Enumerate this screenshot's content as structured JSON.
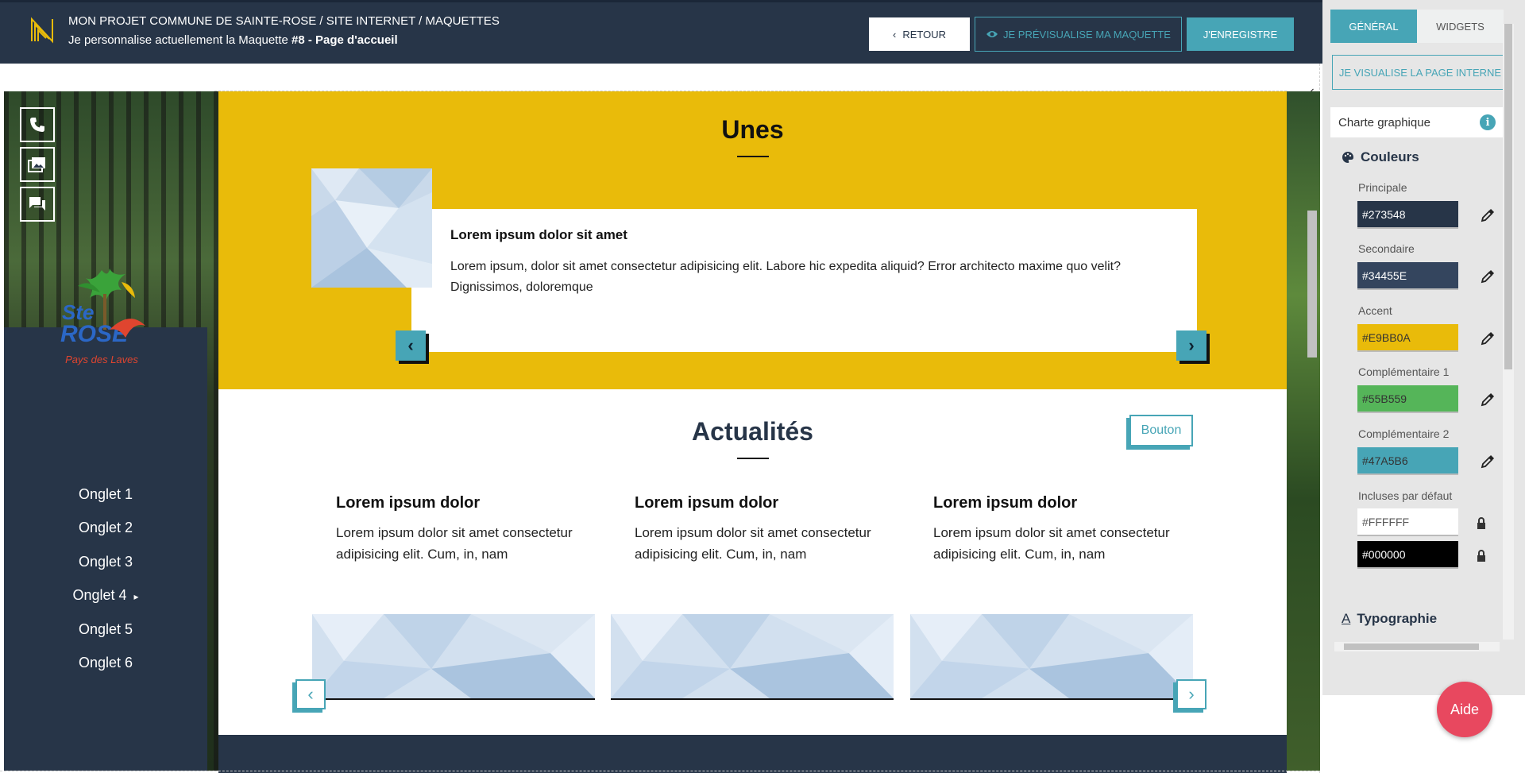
{
  "header": {
    "path": "MON PROJET COMMUNE DE SAINTE-ROSE / SITE INTERNET / MAQUETTES",
    "subtitle_prefix": "Je personnalise actuellement la Maquette",
    "subtitle_bold": "#8 - Page d'accueil",
    "back_label": "RETOUR",
    "preview_label": "JE PRÉVISUALISE MA MAQUETTE",
    "save_label": "J'ENREGISTRE"
  },
  "site": {
    "logo_text": "Pays des Laves",
    "nav": [
      "Onglet 1",
      "Onglet 2",
      "Onglet 3",
      "Onglet 4",
      "Onglet 5",
      "Onglet 6"
    ],
    "quick_icons": [
      "phone-icon",
      "gallery-icon",
      "chat-icon"
    ]
  },
  "unes": {
    "title": "Unes",
    "card_title": "Lorem ipsum dolor sit amet",
    "card_text": "Lorem ipsum, dolor sit amet consectetur adipisicing elit. Labore hic expedita aliquid? Error architecto maxime quo velit? Dignissimos, doloremque"
  },
  "actualites": {
    "title": "Actualités",
    "button": "Bouton",
    "items": [
      {
        "title": "Lorem ipsum dolor",
        "text": "Lorem ipsum dolor sit amet consectetur adipisicing elit. Cum, in, nam"
      },
      {
        "title": "Lorem ipsum dolor",
        "text": "Lorem ipsum dolor sit amet consectetur adipisicing elit. Cum, in, nam"
      },
      {
        "title": "Lorem ipsum dolor",
        "text": "Lorem ipsum dolor sit amet consectetur adipisicing elit. Cum, in, nam"
      }
    ]
  },
  "panel": {
    "tabs": [
      "GÉNÉRAL",
      "WIDGETS"
    ],
    "active_tab": "GÉNÉRAL",
    "page_button": "JE VISUALISE LA PAGE INTERNE",
    "charte": "Charte graphique",
    "couleurs": "Couleurs",
    "colors": [
      {
        "label": "Principale",
        "value": "#273548",
        "text_color": "#ffffff"
      },
      {
        "label": "Secondaire",
        "value": "#34455E",
        "text_color": "#ffffff"
      },
      {
        "label": "Accent",
        "value": "#E9BB0A",
        "text_color": "#333333"
      },
      {
        "label": "Complémentaire 1",
        "value": "#55B559",
        "text_color": "#333333"
      },
      {
        "label": "Complémentaire 2",
        "value": "#47A5B6",
        "text_color": "#333333"
      }
    ],
    "defaults_label": "Incluses par défaut",
    "defaults": [
      "#FFFFFF",
      "#000000"
    ],
    "typographie": "Typographie",
    "help": "Aide"
  }
}
